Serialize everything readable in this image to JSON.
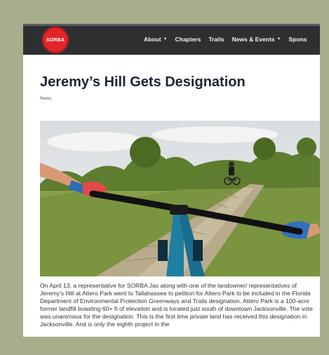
{
  "site": {
    "logo_text": "SORBA",
    "brand_color": "#e0262b",
    "nav_background": "#2e2f31"
  },
  "nav": {
    "items": [
      {
        "label": "About",
        "has_dropdown": true
      },
      {
        "label": "Chapters",
        "has_dropdown": false
      },
      {
        "label": "Trails",
        "has_dropdown": false
      },
      {
        "label": "News & Events",
        "has_dropdown": true
      },
      {
        "label": "Spons",
        "has_dropdown": false
      }
    ]
  },
  "article": {
    "title": "Jeremy’s Hill Gets Designation",
    "category": "News",
    "image_subject": "mountain-bike-trail-photo",
    "body": "On April 13, a representative for SORBA Jax along with one of the landowner/ representatives of Jeremy's Hill at Attero Park went to Tallahassee to petition for Attero Park to be included in the Florida Department of Environmental Protection Greenways and Trails designation. Attero Park is a 100-acre former landfill boasting 60+ ft of elevation and is located just south of downtown Jacksonville. The vote was unanimous for the designation. This is the first time private land has received this designation in Jacksonville. And is only the eighth project in the"
  }
}
